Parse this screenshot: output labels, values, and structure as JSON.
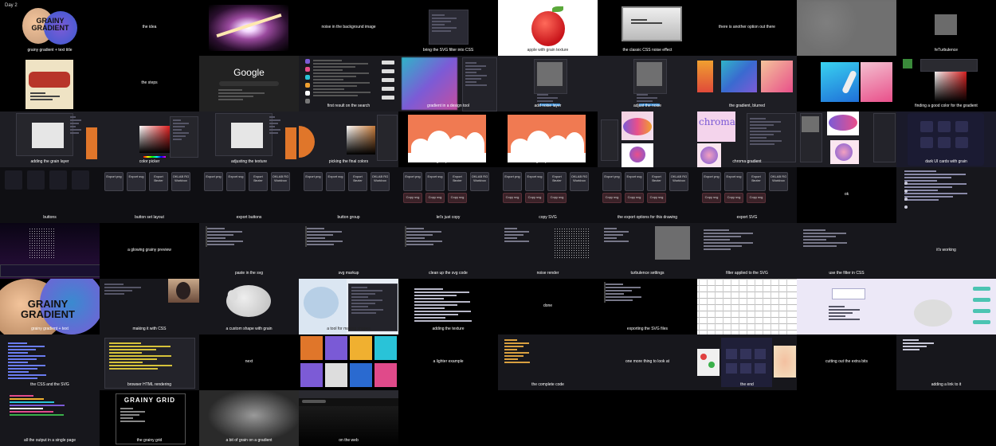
{
  "header": {
    "day_label": "Day 2"
  },
  "tiles": [
    {
      "col": 0,
      "row": 0,
      "variant": "gradient_title",
      "bg": "#000",
      "caption": "grainy gradient + text title"
    },
    {
      "col": 1,
      "row": 0,
      "variant": "text",
      "bg": "#000",
      "caption": "the idea"
    },
    {
      "col": 2,
      "row": 0,
      "variant": "burst",
      "bg": "#000",
      "caption": ""
    },
    {
      "col": 3,
      "row": 0,
      "variant": "text",
      "bg": "#000",
      "caption": "noise in the background image"
    },
    {
      "col": 4,
      "row": 0,
      "variant": "dialog",
      "bg": "#000",
      "caption": "bring the SVG filter into CSS"
    },
    {
      "col": 5,
      "row": 0,
      "variant": "apple",
      "bg": "#fff",
      "caption": "apple with grain texture"
    },
    {
      "col": 6,
      "row": 0,
      "variant": "photo",
      "bg": "#000",
      "caption": "the classic CSS noise effect"
    },
    {
      "col": 7,
      "row": 0,
      "variant": "text",
      "bg": "#000",
      "caption": "there is another option out there"
    },
    {
      "col": 8,
      "row": 0,
      "variant": "blurnoise",
      "bg": "#000",
      "caption": ""
    },
    {
      "col": 9,
      "row": 0,
      "variant": "smallnoise",
      "bg": "#000",
      "caption": "feTurbulence"
    },
    {
      "col": 0,
      "row": 1,
      "variant": "couch",
      "bg": "#000",
      "caption": ""
    },
    {
      "col": 1,
      "row": 1,
      "variant": "text",
      "bg": "#000",
      "caption": "the steps"
    },
    {
      "col": 2,
      "row": 1,
      "variant": "google",
      "bg": "#222",
      "caption": ""
    },
    {
      "col": 3,
      "row": 1,
      "variant": "list",
      "bg": "#1a1a1f",
      "caption": "first result on the search"
    },
    {
      "col": 4,
      "row": 1,
      "variant": "purplegrad",
      "bg": "#1a1a1f",
      "caption": "gradient in a design tool"
    },
    {
      "col": 5,
      "row": 1,
      "variant": "toolpanel",
      "bg": "#1e1e24",
      "caption": "add noise layer"
    },
    {
      "col": 6,
      "row": 1,
      "variant": "toolpanel",
      "bg": "#1e1e24",
      "caption": "adjust the noise"
    },
    {
      "col": 7,
      "row": 1,
      "variant": "colorful",
      "bg": "#1e1e24",
      "caption": "the gradient, blurred"
    },
    {
      "col": 8,
      "row": 1,
      "variant": "cyanhand",
      "bg": "#000",
      "caption": ""
    },
    {
      "col": 9,
      "row": 1,
      "variant": "colorpick",
      "bg": "#000",
      "caption": "finding a good color for the gradient"
    },
    {
      "col": 0,
      "row": 2,
      "variant": "panelwhite",
      "bg": "#1e1e24",
      "caption": "adding the grain layer"
    },
    {
      "col": 1,
      "row": 2,
      "variant": "colorpick2",
      "bg": "#1e1e24",
      "caption": "color picker"
    },
    {
      "col": 2,
      "row": 2,
      "variant": "panelwhite",
      "bg": "#1e1e24",
      "caption": "adjusting the texture"
    },
    {
      "col": 3,
      "row": 2,
      "variant": "colorpick3",
      "bg": "#1e1e24",
      "caption": "picking the final colors"
    },
    {
      "col": 4,
      "row": 2,
      "variant": "clouds",
      "bg": "#000",
      "caption": "grainy clouds"
    },
    {
      "col": 5,
      "row": 2,
      "variant": "clouds",
      "bg": "#000",
      "caption": "grainy clouds"
    },
    {
      "col": 6,
      "row": 2,
      "variant": "chroma",
      "bg": "#1e1e24",
      "caption": ""
    },
    {
      "col": 7,
      "row": 2,
      "variant": "chroma2",
      "bg": "#1e1e24",
      "caption": "chroma gradient"
    },
    {
      "col": 8,
      "row": 2,
      "variant": "chroma3",
      "bg": "#1e1e24",
      "caption": ""
    },
    {
      "col": 9,
      "row": 2,
      "variant": "iconsdark",
      "bg": "#1a1a2a",
      "caption": "dark UI cards with grain"
    },
    {
      "col": 0,
      "row": 3,
      "variant": "emptybtns",
      "bg": "#0f0f13",
      "caption": "buttons"
    },
    {
      "col": 1,
      "row": 3,
      "variant": "btns",
      "bg": "#0f0f13",
      "caption": "button set layout"
    },
    {
      "col": 2,
      "row": 3,
      "variant": "btns",
      "bg": "#0f0f13",
      "caption": "export buttons"
    },
    {
      "col": 3,
      "row": 3,
      "variant": "btns",
      "bg": "#0f0f13",
      "caption": "button group"
    },
    {
      "col": 4,
      "row": 3,
      "variant": "btnsred",
      "bg": "#0f0f13",
      "caption": "let's just copy"
    },
    {
      "col": 5,
      "row": 3,
      "variant": "btnsred",
      "bg": "#0f0f13",
      "caption": "copy SVG"
    },
    {
      "col": 6,
      "row": 3,
      "variant": "btnsred",
      "bg": "#0f0f13",
      "caption": "the export options for this drawing"
    },
    {
      "col": 7,
      "row": 3,
      "variant": "btnsred",
      "bg": "#0f0f13",
      "caption": "export SVG"
    },
    {
      "col": 8,
      "row": 3,
      "variant": "text",
      "bg": "#000",
      "caption": "ok"
    },
    {
      "col": 9,
      "row": 3,
      "variant": "codelist",
      "bg": "#17171c",
      "caption": ""
    },
    {
      "col": 0,
      "row": 4,
      "variant": "purplenoise",
      "bg": "#000",
      "caption": ""
    },
    {
      "col": 1,
      "row": 4,
      "variant": "text",
      "bg": "#000",
      "caption": "a glowing grainy preview"
    },
    {
      "col": 2,
      "row": 4,
      "variant": "editorsmall",
      "bg": "#17171c",
      "caption": "paste in the svg"
    },
    {
      "col": 3,
      "row": 4,
      "variant": "editorsmall",
      "bg": "#17171c",
      "caption": "svg markup"
    },
    {
      "col": 4,
      "row": 4,
      "variant": "editorsmall",
      "bg": "#17171c",
      "caption": "clean up the svg code"
    },
    {
      "col": 5,
      "row": 4,
      "variant": "editornoise",
      "bg": "#17171c",
      "caption": "noise render"
    },
    {
      "col": 6,
      "row": 4,
      "variant": "editornoise2",
      "bg": "#17171c",
      "caption": "turbulence settings"
    },
    {
      "col": 7,
      "row": 4,
      "variant": "editorwide",
      "bg": "#17171c",
      "caption": "filter applied to the SVG"
    },
    {
      "col": 8,
      "row": 4,
      "variant": "editorwide2",
      "bg": "#17171c",
      "caption": "use the filter in CSS"
    },
    {
      "col": 9,
      "row": 4,
      "variant": "text",
      "bg": "#17171c",
      "caption": "it's working"
    },
    {
      "col": 0,
      "row": 5,
      "variant": "gradient_title_big",
      "bg": "#000",
      "caption": "grainy gradient + text"
    },
    {
      "col": 1,
      "row": 5,
      "variant": "webcam",
      "bg": "#17171c",
      "caption": "making it with CSS"
    },
    {
      "col": 2,
      "row": 5,
      "variant": "blobshape",
      "bg": "#17171c",
      "caption": "a custom shape with grain"
    },
    {
      "col": 3,
      "row": 5,
      "variant": "lightui",
      "bg": "#e8eef5",
      "caption": "a tool for making shapes"
    },
    {
      "col": 4,
      "row": 5,
      "variant": "editorcode",
      "bg": "#000",
      "caption": "adding the texture"
    },
    {
      "col": 5,
      "row": 5,
      "variant": "text",
      "bg": "#000",
      "caption": "done"
    },
    {
      "col": 6,
      "row": 5,
      "variant": "editorsmall",
      "bg": "#000",
      "caption": "exporting the SVG files"
    },
    {
      "col": 7,
      "row": 5,
      "variant": "spreadsheet",
      "bg": "#fff",
      "caption": ""
    },
    {
      "col": 8,
      "row": 5,
      "variant": "lavpage",
      "bg": "#eceaf7",
      "caption": ""
    },
    {
      "col": 9,
      "row": 5,
      "variant": "lightblob",
      "bg": "#eceaf7",
      "caption": ""
    },
    {
      "col": 0,
      "row": 6,
      "variant": "bluecode",
      "bg": "#17171c",
      "caption": "the CSS and the SVG"
    },
    {
      "col": 1,
      "row": 6,
      "variant": "yellowcode",
      "bg": "#17171c",
      "caption": "browser HTML rendering"
    },
    {
      "col": 2,
      "row": 6,
      "variant": "text",
      "bg": "#000",
      "caption": "next"
    },
    {
      "col": 3,
      "row": 6,
      "variant": "thumbs",
      "bg": "#000",
      "caption": ""
    },
    {
      "col": 4,
      "row": 6,
      "variant": "text",
      "bg": "#000",
      "caption": "a lighter example"
    },
    {
      "col": 5,
      "row": 6,
      "variant": "smallcode",
      "bg": "#17171c",
      "caption": "the complete code"
    },
    {
      "col": 6,
      "row": 6,
      "variant": "text",
      "bg": "#17171c",
      "caption": "one more thing to look at"
    },
    {
      "col": 7,
      "row": 6,
      "variant": "uicards",
      "bg": "#17171c",
      "caption": "the end"
    },
    {
      "col": 8,
      "row": 6,
      "variant": "text",
      "bg": "#000",
      "caption": "cutting out the extra bits"
    },
    {
      "col": 9,
      "row": 6,
      "variant": "smallcode2",
      "bg": "#17171c",
      "caption": "adding a link to it"
    },
    {
      "col": 0,
      "row": 7,
      "variant": "colorcode",
      "bg": "#17171c",
      "caption": "all the output in a single page"
    },
    {
      "col": 1,
      "row": 7,
      "variant": "grainygrid",
      "bg": "#000",
      "caption": "the grainy grid"
    },
    {
      "col": 2,
      "row": 7,
      "variant": "spot",
      "bg": "#2a2a2a",
      "caption": "a bit of grain on a gradient"
    },
    {
      "col": 3,
      "row": 7,
      "variant": "browserdark",
      "bg": "#111",
      "caption": "on the web"
    }
  ],
  "texts": {
    "grainy_line1": "GRAINY",
    "grainy_line2": "GRADIENT",
    "google": "Google",
    "chroma": "chroma",
    "grid_title": "GRAINY GRID",
    "btn_labels": [
      "Export png",
      "Export svg",
      "Export Bezier",
      "OKLAB RG Workbox"
    ],
    "btn_red_labels": [
      "Copy svg",
      "Copy svg",
      "Copy svg"
    ]
  },
  "colors": {
    "orange": "#f07a52",
    "purple": "#7c5bd6",
    "cyan": "#29c3d8",
    "pink": "#e94f8a",
    "peach": "#f3c49b"
  }
}
